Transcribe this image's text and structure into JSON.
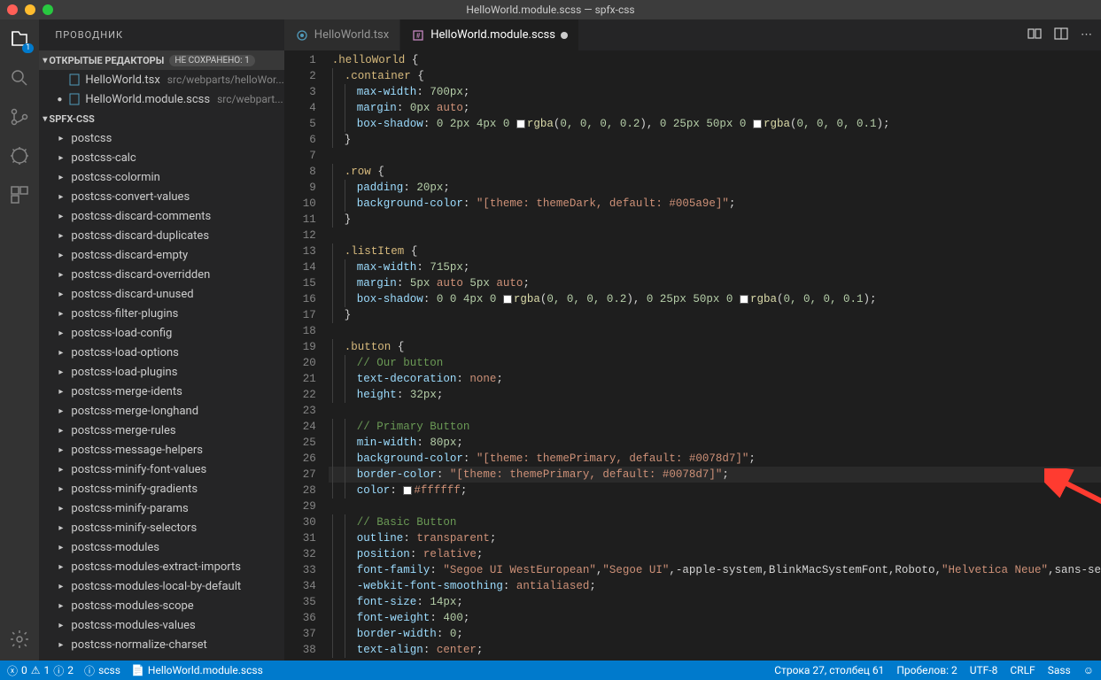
{
  "titlebar": {
    "title": "HelloWorld.module.scss — spfx-css"
  },
  "activitybar": {
    "explorer_badge": "1"
  },
  "sidebar": {
    "title": "ПРОВОДНИК",
    "open_editors_label": "ОТКРЫТЫЕ РЕДАКТОРЫ",
    "unsaved_label": "НЕ СОХРАНЕНО: 1",
    "project_label": "SPFX-CSS",
    "open_editors": [
      {
        "name": "HelloWorld.tsx",
        "path": "src/webparts/helloWor...",
        "modified": false
      },
      {
        "name": "HelloWorld.module.scss",
        "path": "src/webpart...",
        "modified": true
      }
    ],
    "tree": [
      "postcss",
      "postcss-calc",
      "postcss-colormin",
      "postcss-convert-values",
      "postcss-discard-comments",
      "postcss-discard-duplicates",
      "postcss-discard-empty",
      "postcss-discard-overridden",
      "postcss-discard-unused",
      "postcss-filter-plugins",
      "postcss-load-config",
      "postcss-load-options",
      "postcss-load-plugins",
      "postcss-merge-idents",
      "postcss-merge-longhand",
      "postcss-merge-rules",
      "postcss-message-helpers",
      "postcss-minify-font-values",
      "postcss-minify-gradients",
      "postcss-minify-params",
      "postcss-minify-selectors",
      "postcss-modules",
      "postcss-modules-extract-imports",
      "postcss-modules-local-by-default",
      "postcss-modules-scope",
      "postcss-modules-values",
      "postcss-normalize-charset"
    ]
  },
  "tabs": {
    "items": [
      {
        "label": "HelloWorld.tsx",
        "modified": false
      },
      {
        "label": "HelloWorld.module.scss",
        "modified": true
      }
    ]
  },
  "code": {
    "lines": [
      [
        {
          "t": "sel",
          "v": ".helloWorld"
        },
        {
          "t": "punc",
          "v": " {"
        }
      ],
      [
        {
          "t": "ind",
          "n": 1
        },
        {
          "t": "sel",
          "v": ".container"
        },
        {
          "t": "punc",
          "v": " {"
        }
      ],
      [
        {
          "t": "ind",
          "n": 2
        },
        {
          "t": "prop",
          "v": "max-width"
        },
        {
          "t": "punc",
          "v": ": "
        },
        {
          "t": "num",
          "v": "700px"
        },
        {
          "t": "punc",
          "v": ";"
        }
      ],
      [
        {
          "t": "ind",
          "n": 2
        },
        {
          "t": "prop",
          "v": "margin"
        },
        {
          "t": "punc",
          "v": ": "
        },
        {
          "t": "num",
          "v": "0px"
        },
        {
          "t": "punc",
          "v": " "
        },
        {
          "t": "kw",
          "v": "auto"
        },
        {
          "t": "punc",
          "v": ";"
        }
      ],
      [
        {
          "t": "ind",
          "n": 2
        },
        {
          "t": "prop",
          "v": "box-shadow"
        },
        {
          "t": "punc",
          "v": ": "
        },
        {
          "t": "num",
          "v": "0 2px 4px 0 "
        },
        {
          "t": "swatch",
          "c": "white"
        },
        {
          "t": "fn",
          "v": "rgba"
        },
        {
          "t": "punc",
          "v": "("
        },
        {
          "t": "num",
          "v": "0, 0, 0, 0.2"
        },
        {
          "t": "punc",
          "v": "), "
        },
        {
          "t": "num",
          "v": "0 25px 50px 0 "
        },
        {
          "t": "swatch",
          "c": "white"
        },
        {
          "t": "fn",
          "v": "rgba"
        },
        {
          "t": "punc",
          "v": "("
        },
        {
          "t": "num",
          "v": "0, 0, 0, 0.1"
        },
        {
          "t": "punc",
          "v": ");"
        }
      ],
      [
        {
          "t": "ind",
          "n": 1
        },
        {
          "t": "punc",
          "v": "}"
        }
      ],
      [],
      [
        {
          "t": "ind",
          "n": 1
        },
        {
          "t": "sel",
          "v": ".row"
        },
        {
          "t": "punc",
          "v": " {"
        }
      ],
      [
        {
          "t": "ind",
          "n": 2
        },
        {
          "t": "prop",
          "v": "padding"
        },
        {
          "t": "punc",
          "v": ": "
        },
        {
          "t": "num",
          "v": "20px"
        },
        {
          "t": "punc",
          "v": ";"
        }
      ],
      [
        {
          "t": "ind",
          "n": 2
        },
        {
          "t": "prop",
          "v": "background-color"
        },
        {
          "t": "punc",
          "v": ": "
        },
        {
          "t": "str",
          "v": "\"[theme: themeDark, default: #005a9e]\""
        },
        {
          "t": "punc",
          "v": ";"
        }
      ],
      [
        {
          "t": "ind",
          "n": 1
        },
        {
          "t": "punc",
          "v": "}"
        }
      ],
      [],
      [
        {
          "t": "ind",
          "n": 1
        },
        {
          "t": "sel",
          "v": ".listItem"
        },
        {
          "t": "punc",
          "v": " {"
        }
      ],
      [
        {
          "t": "ind",
          "n": 2
        },
        {
          "t": "prop",
          "v": "max-width"
        },
        {
          "t": "punc",
          "v": ": "
        },
        {
          "t": "num",
          "v": "715px"
        },
        {
          "t": "punc",
          "v": ";"
        }
      ],
      [
        {
          "t": "ind",
          "n": 2
        },
        {
          "t": "prop",
          "v": "margin"
        },
        {
          "t": "punc",
          "v": ": "
        },
        {
          "t": "num",
          "v": "5px"
        },
        {
          "t": "punc",
          "v": " "
        },
        {
          "t": "kw",
          "v": "auto"
        },
        {
          "t": "punc",
          "v": " "
        },
        {
          "t": "num",
          "v": "5px"
        },
        {
          "t": "punc",
          "v": " "
        },
        {
          "t": "kw",
          "v": "auto"
        },
        {
          "t": "punc",
          "v": ";"
        }
      ],
      [
        {
          "t": "ind",
          "n": 2
        },
        {
          "t": "prop",
          "v": "box-shadow"
        },
        {
          "t": "punc",
          "v": ": "
        },
        {
          "t": "num",
          "v": "0 0 4px 0 "
        },
        {
          "t": "swatch",
          "c": "white"
        },
        {
          "t": "fn",
          "v": "rgba"
        },
        {
          "t": "punc",
          "v": "("
        },
        {
          "t": "num",
          "v": "0, 0, 0, 0.2"
        },
        {
          "t": "punc",
          "v": "), "
        },
        {
          "t": "num",
          "v": "0 25px 50px 0 "
        },
        {
          "t": "swatch",
          "c": "white"
        },
        {
          "t": "fn",
          "v": "rgba"
        },
        {
          "t": "punc",
          "v": "("
        },
        {
          "t": "num",
          "v": "0, 0, 0, 0.1"
        },
        {
          "t": "punc",
          "v": ");"
        }
      ],
      [
        {
          "t": "ind",
          "n": 1
        },
        {
          "t": "punc",
          "v": "}"
        }
      ],
      [],
      [
        {
          "t": "ind",
          "n": 1
        },
        {
          "t": "sel",
          "v": ".button"
        },
        {
          "t": "punc",
          "v": " {"
        }
      ],
      [
        {
          "t": "ind",
          "n": 2
        },
        {
          "t": "comment",
          "v": "// Our button"
        }
      ],
      [
        {
          "t": "ind",
          "n": 2
        },
        {
          "t": "prop",
          "v": "text-decoration"
        },
        {
          "t": "punc",
          "v": ": "
        },
        {
          "t": "kw",
          "v": "none"
        },
        {
          "t": "punc",
          "v": ";"
        }
      ],
      [
        {
          "t": "ind",
          "n": 2
        },
        {
          "t": "prop",
          "v": "height"
        },
        {
          "t": "punc",
          "v": ": "
        },
        {
          "t": "num",
          "v": "32px"
        },
        {
          "t": "punc",
          "v": ";"
        }
      ],
      [],
      [
        {
          "t": "ind",
          "n": 2
        },
        {
          "t": "comment",
          "v": "// Primary Button"
        }
      ],
      [
        {
          "t": "ind",
          "n": 2
        },
        {
          "t": "prop",
          "v": "min-width"
        },
        {
          "t": "punc",
          "v": ": "
        },
        {
          "t": "num",
          "v": "80px"
        },
        {
          "t": "punc",
          "v": ";"
        }
      ],
      [
        {
          "t": "ind",
          "n": 2
        },
        {
          "t": "prop",
          "v": "background-color"
        },
        {
          "t": "punc",
          "v": ": "
        },
        {
          "t": "str",
          "v": "\"[theme: themePrimary, default: #0078d7]\""
        },
        {
          "t": "punc",
          "v": ";"
        }
      ],
      [
        {
          "t": "ind",
          "n": 2
        },
        {
          "t": "prop",
          "v": "border-color"
        },
        {
          "t": "punc",
          "v": ": "
        },
        {
          "t": "str",
          "v": "\"[theme: themePrimary, default: #0078d7]\""
        },
        {
          "t": "punc",
          "v": ";"
        }
      ],
      [
        {
          "t": "ind",
          "n": 2
        },
        {
          "t": "prop",
          "v": "color"
        },
        {
          "t": "punc",
          "v": ": "
        },
        {
          "t": "swatch",
          "c": "white"
        },
        {
          "t": "str",
          "v": "#ffffff"
        },
        {
          "t": "punc",
          "v": ";"
        }
      ],
      [],
      [
        {
          "t": "ind",
          "n": 2
        },
        {
          "t": "comment",
          "v": "// Basic Button"
        }
      ],
      [
        {
          "t": "ind",
          "n": 2
        },
        {
          "t": "prop",
          "v": "outline"
        },
        {
          "t": "punc",
          "v": ": "
        },
        {
          "t": "kw",
          "v": "transparent"
        },
        {
          "t": "punc",
          "v": ";"
        }
      ],
      [
        {
          "t": "ind",
          "n": 2
        },
        {
          "t": "prop",
          "v": "position"
        },
        {
          "t": "punc",
          "v": ": "
        },
        {
          "t": "kw",
          "v": "relative"
        },
        {
          "t": "punc",
          "v": ";"
        }
      ],
      [
        {
          "t": "ind",
          "n": 2
        },
        {
          "t": "prop",
          "v": "font-family"
        },
        {
          "t": "punc",
          "v": ": "
        },
        {
          "t": "str",
          "v": "\"Segoe UI WestEuropean\""
        },
        {
          "t": "punc",
          "v": ","
        },
        {
          "t": "str",
          "v": "\"Segoe UI\""
        },
        {
          "t": "punc",
          "v": ",-apple-system,BlinkMacSystemFont,Roboto,"
        },
        {
          "t": "str",
          "v": "\"Helvetica Neue\""
        },
        {
          "t": "punc",
          "v": ",sans-se"
        }
      ],
      [
        {
          "t": "ind",
          "n": 2
        },
        {
          "t": "prop",
          "v": "-webkit-font-smoothing"
        },
        {
          "t": "punc",
          "v": ": "
        },
        {
          "t": "kw",
          "v": "antialiased"
        },
        {
          "t": "punc",
          "v": ";"
        }
      ],
      [
        {
          "t": "ind",
          "n": 2
        },
        {
          "t": "prop",
          "v": "font-size"
        },
        {
          "t": "punc",
          "v": ": "
        },
        {
          "t": "num",
          "v": "14px"
        },
        {
          "t": "punc",
          "v": ";"
        }
      ],
      [
        {
          "t": "ind",
          "n": 2
        },
        {
          "t": "prop",
          "v": "font-weight"
        },
        {
          "t": "punc",
          "v": ": "
        },
        {
          "t": "num",
          "v": "400"
        },
        {
          "t": "punc",
          "v": ";"
        }
      ],
      [
        {
          "t": "ind",
          "n": 2
        },
        {
          "t": "prop",
          "v": "border-width"
        },
        {
          "t": "punc",
          "v": ": "
        },
        {
          "t": "num",
          "v": "0"
        },
        {
          "t": "punc",
          "v": ";"
        }
      ],
      [
        {
          "t": "ind",
          "n": 2
        },
        {
          "t": "prop",
          "v": "text-align"
        },
        {
          "t": "punc",
          "v": ": "
        },
        {
          "t": "kw",
          "v": "center"
        },
        {
          "t": "punc",
          "v": ";"
        }
      ]
    ],
    "highlight_line": 27
  },
  "status": {
    "errors": "0",
    "warnings": "1",
    "infos": "2",
    "lang_info": "scss",
    "file": "HelloWorld.module.scss",
    "cursor": "Строка 27, столбец 61",
    "spaces": "Пробелов: 2",
    "encoding": "UTF-8",
    "eol": "CRLF",
    "language": "Sass"
  }
}
